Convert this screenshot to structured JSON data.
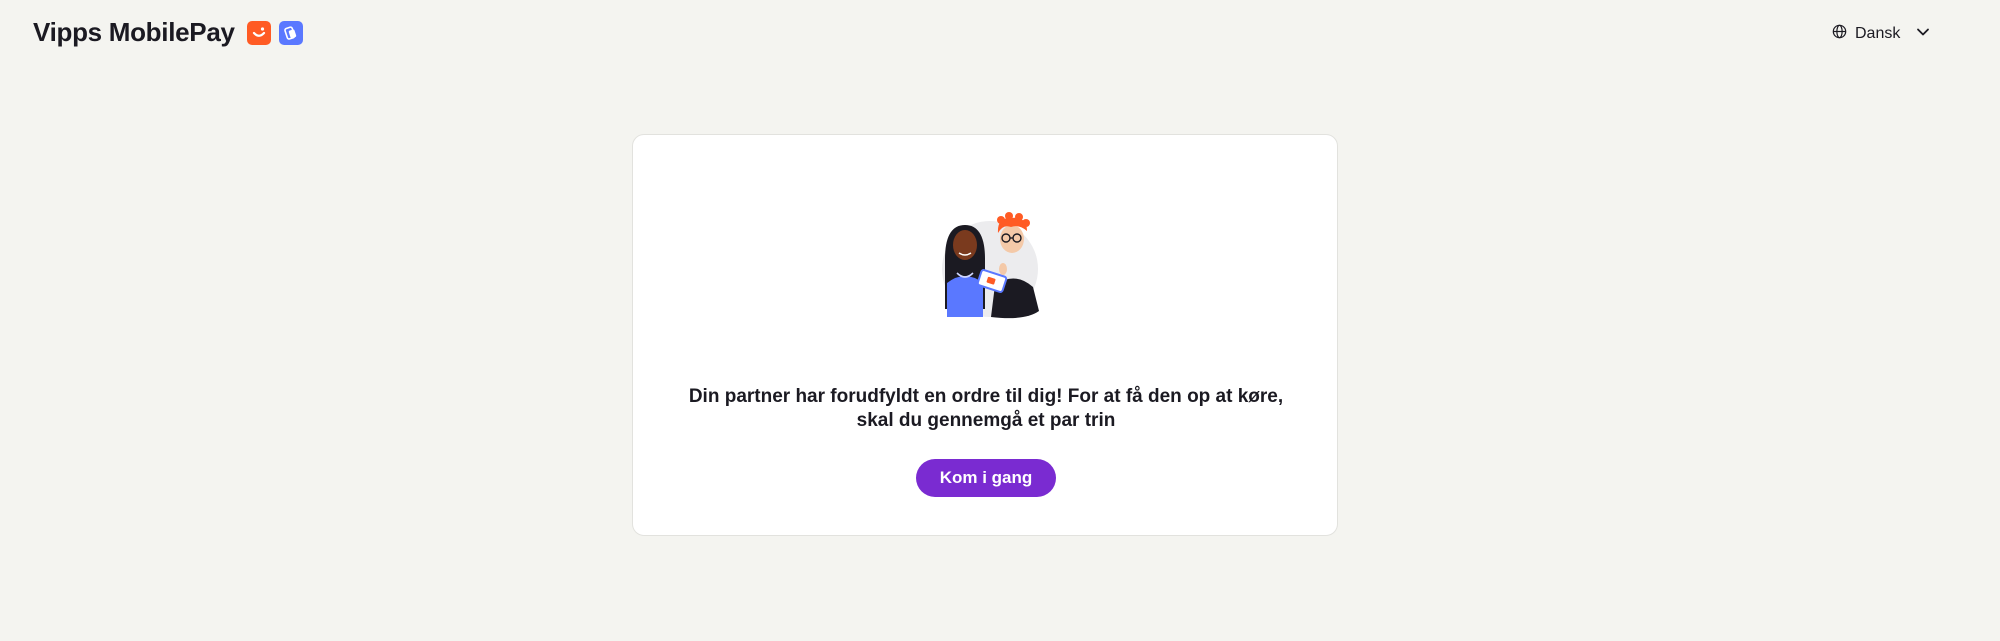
{
  "header": {
    "brand_name": "Vipps MobilePay",
    "brand_icons": [
      "vipps-smile-icon",
      "mobilepay-icon"
    ],
    "language": {
      "label": "Dansk",
      "icon": "globe-icon",
      "dropdown_icon": "chevron-down-icon"
    }
  },
  "card": {
    "illustration": "partners-illustration",
    "message_line1": "Din partner har forudfyldt en ordre til dig! For at få den op at køre,",
    "message_line2": "skal du gennemgå et par trin",
    "cta_label": "Kom i gang"
  },
  "colors": {
    "background": "#f4f4f0",
    "card": "#ffffff",
    "vipps_orange": "#ff5b24",
    "mobilepay_blue": "#5a78ff",
    "cta_purple": "#7a2bd1",
    "text": "#1b1a22"
  }
}
